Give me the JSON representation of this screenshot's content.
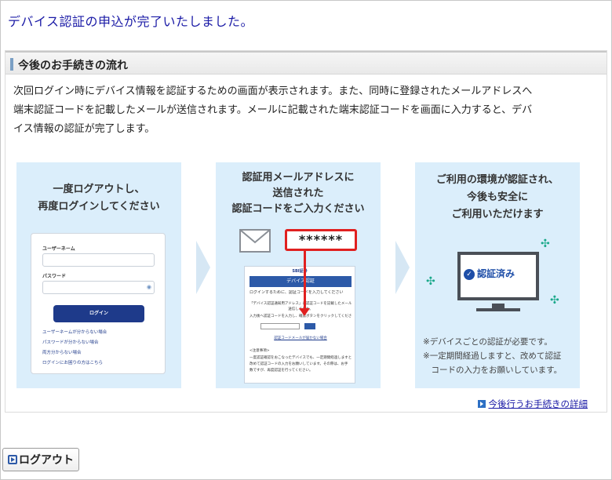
{
  "page": {
    "title": "デバイス認証の申込が完了いたしました。"
  },
  "section": {
    "heading": "今後のお手続きの流れ",
    "intro_lines": [
      "次回ログイン時にデバイス情報を認証するための画面が表示されます。また、同時に登録されたメールアドレスへ",
      "端末認証コードを記載したメールが送信されます。メールに記載された端末認証コードを画面に入力すると、デバ",
      "イス情報の認証が完了します。"
    ]
  },
  "steps": [
    {
      "heading_lines": [
        "一度ログアウトし、",
        "再度ログインしてください"
      ],
      "login_mock": {
        "username_label": "ユーザーネーム",
        "password_label": "パスワード",
        "login_button": "ログイン",
        "links": [
          "ユーザーネームが分からない場合",
          "パスワードが分からない場合",
          "両方分からない場合",
          "ログインにお困りの方はこちら"
        ]
      }
    },
    {
      "heading_lines": [
        "認証用メールアドレスに",
        "送信された",
        "認証コードをご入力ください"
      ],
      "code_bubble": "******",
      "phone_mock": {
        "brand": "SBI証券",
        "header": "デバイス認証",
        "lines": [
          "ログインするために、認証コードを入力してください",
          "「デバイス認証通知用アドレス」に認証コードを記載したメールを",
          "送信しました。",
          "入力後へ認証コードを入力し、確認ボタンをクリックしてください。"
        ],
        "link": "認証コードメールが届かない場合",
        "notes_title": "<注意事項>",
        "notes": [
          "一度認証確認をおこなったデバイスでも、一定期間経過しますと、",
          "改めて認証コードの入力をお願いしています。その際は、お手",
          "数ですが、再度認証を行ってください。"
        ]
      }
    },
    {
      "heading_lines": [
        "ご利用の環境が認証され、",
        "今後も安全に",
        "ご利用いただけます"
      ],
      "verified_label": "認証済み",
      "notes": [
        "※デバイスごとの認証が必要です。",
        "※一定期間経過しますと、改めて認証",
        "　コードの入力をお願いしています。"
      ]
    }
  ],
  "links": {
    "detail": "今後行うお手続きの詳細"
  },
  "footer": {
    "logout_label": "ログアウト"
  }
}
